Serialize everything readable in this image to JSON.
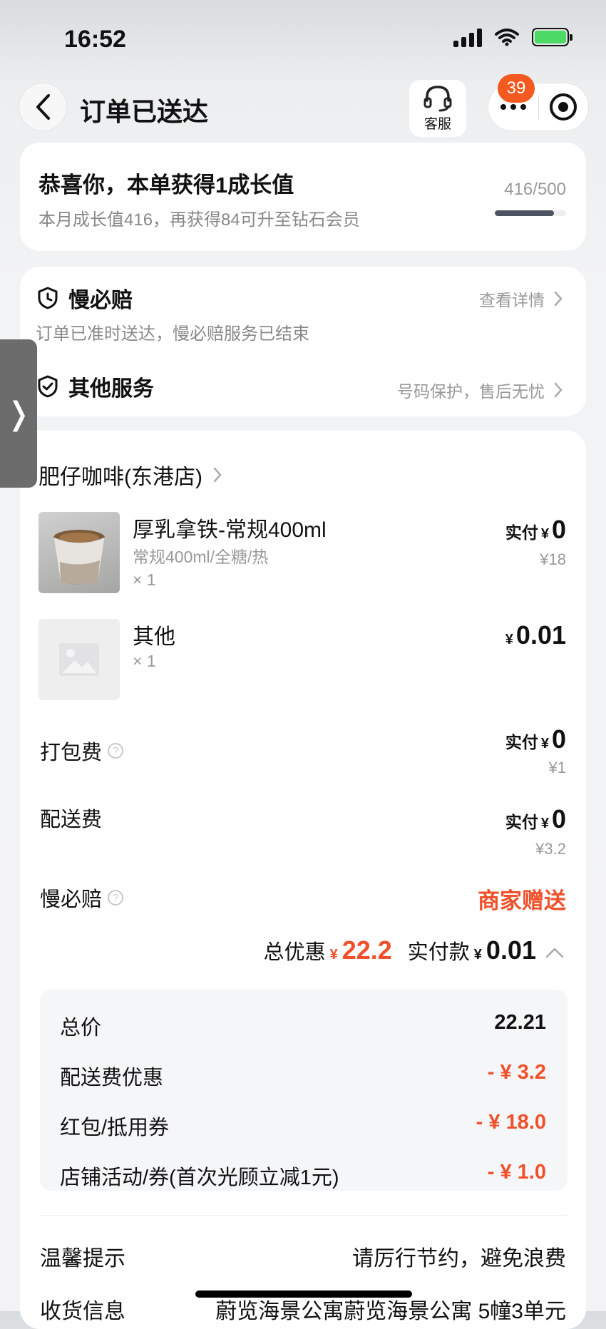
{
  "status_bar": {
    "time": "16:52"
  },
  "nav": {
    "title": "订单已送达",
    "cs_label": "客服",
    "badge": "39"
  },
  "growth": {
    "title": "恭喜你，本单获得1成长值",
    "subtitle": "本月成长值416，再获得84可升至钻石会员",
    "progress_text": "416/500",
    "progress_fraction": 0.832
  },
  "services": {
    "slow_pay": {
      "title": "慢必赔",
      "link": "查看详情",
      "subtitle": "订单已准时送达，慢必赔服务已结束"
    },
    "other": {
      "title": "其他服务",
      "link": "号码保护，售后无忧"
    }
  },
  "side_tab": {
    "glyph": "❭"
  },
  "order": {
    "store": "肥仔咖啡(东港店)",
    "items": [
      {
        "name": "厚乳拿铁-常规400ml",
        "spec": "常规400ml/全糖/热",
        "qty": "× 1",
        "pay_label": "实付",
        "yen": "¥",
        "amount": "0",
        "original": "¥18"
      },
      {
        "name": "其他",
        "qty": "× 1",
        "yen": "¥",
        "amount": "0.01"
      }
    ],
    "fees": [
      {
        "label": "打包费",
        "pay_label": "实付",
        "yen": "¥",
        "amount": "0",
        "original": "¥1"
      },
      {
        "label": "配送费",
        "pay_label": "实付",
        "yen": "¥",
        "amount": "0",
        "original": "¥3.2"
      }
    ],
    "slow_pay_row": {
      "label": "慢必赔",
      "value": "商家赠送"
    },
    "summary": {
      "discount_label": "总优惠",
      "yen": "¥",
      "discount": "22.2",
      "paid_label": "实付款",
      "paid": "0.01"
    },
    "breakdown": [
      {
        "label": "总价",
        "value": "22.21"
      },
      {
        "label": "配送费优惠",
        "value": "- ¥ 3.2"
      },
      {
        "label": "红包/抵用券",
        "value": "- ¥ 18.0"
      },
      {
        "label": "店铺活动/券(首次光顾立减1元)",
        "value": "- ¥ 1.0"
      }
    ],
    "tip": {
      "label": "温馨提示",
      "value": "请厉行节约，避免浪费"
    },
    "delivery": {
      "label": "收货信息",
      "value": "蔚览海景公寓蔚览海景公寓 5幢3单元"
    }
  },
  "colors": {
    "accent_red": "#f0502a",
    "badge": "#f45a1f"
  }
}
